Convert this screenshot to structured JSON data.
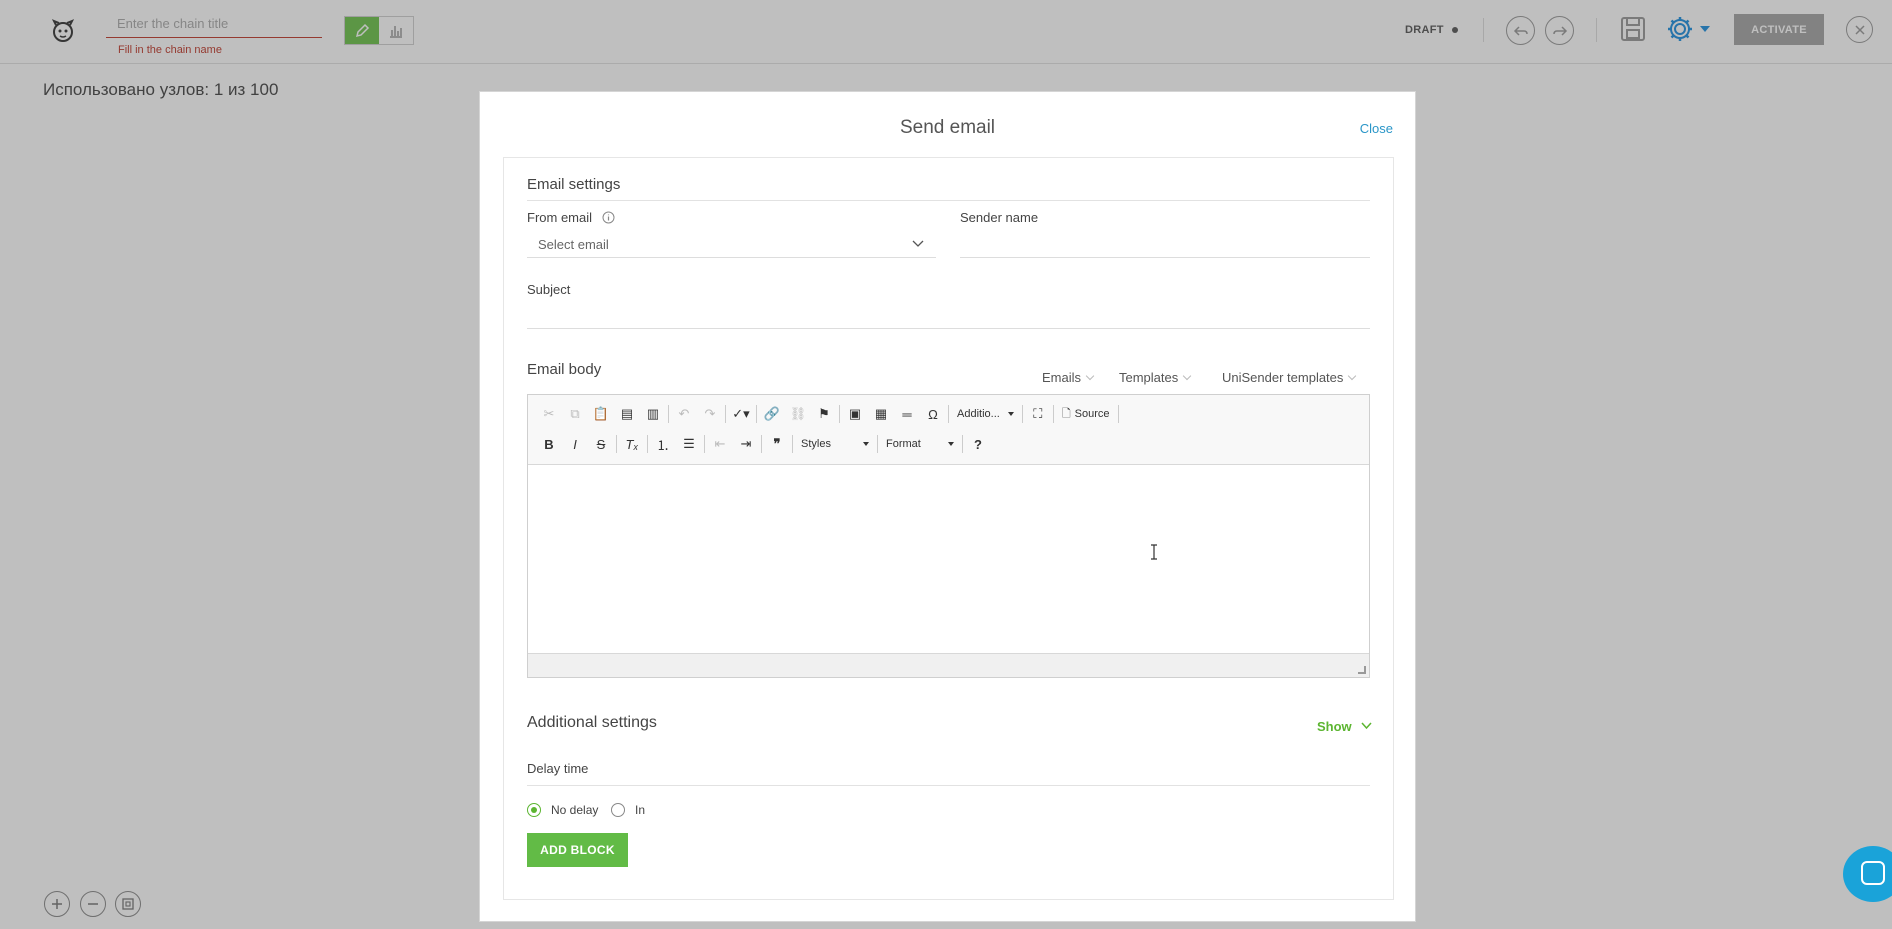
{
  "header": {
    "chain_title_placeholder": "Enter the chain title",
    "chain_title_hint": "Fill in the chain name",
    "status": "DRAFT",
    "activate_label": "ACTIVATE",
    "accent_color": "#6cc24a"
  },
  "canvas": {
    "usage_text": "Использовано узлов: 1 из 100"
  },
  "modal": {
    "title": "Send email",
    "close_label": "Close",
    "email_settings": {
      "title": "Email settings",
      "from_email_label": "From email",
      "from_email_value": "Select email",
      "sender_name_label": "Sender name",
      "sender_name_value": "",
      "subject_label": "Subject",
      "subject_value": ""
    },
    "email_body": {
      "title": "Email body",
      "menus": [
        "Emails",
        "Templates",
        "UniSender templates"
      ],
      "toolbar": {
        "additional_combo": "Additio...",
        "source_label": "Source",
        "styles_combo": "Styles",
        "format_combo": "Format",
        "help_label": "?"
      }
    },
    "additional_settings": {
      "title": "Additional settings",
      "show_label": "Show"
    },
    "delay": {
      "title": "Delay time",
      "options": [
        {
          "label": "No delay",
          "selected": true
        },
        {
          "label": "In",
          "selected": false
        }
      ]
    },
    "add_block_label": "ADD BLOCK"
  }
}
